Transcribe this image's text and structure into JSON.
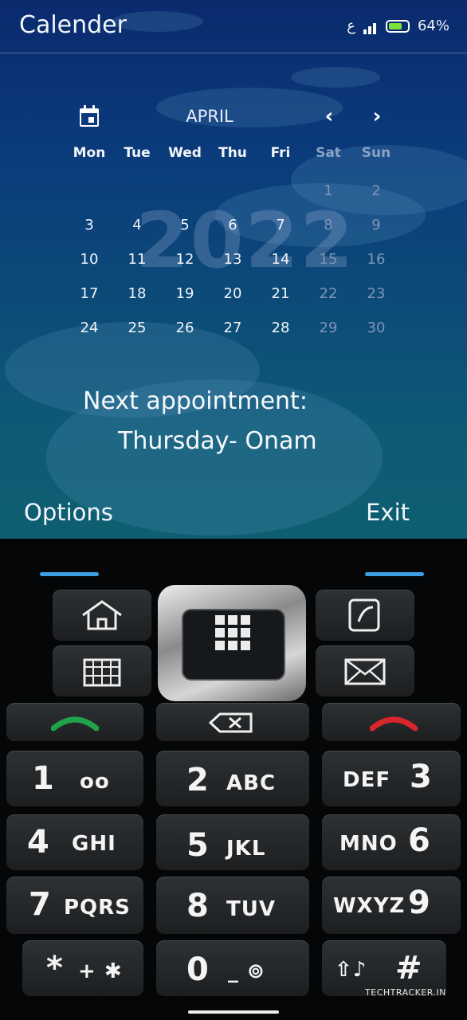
{
  "app": {
    "title": "Calender"
  },
  "status_bar": {
    "carrier_glyph": "ع",
    "battery_percent": "64%",
    "battery_level": 0.64,
    "signal_icon": "signal-bars-icon"
  },
  "calendar": {
    "month": "APRIL",
    "year": "2022",
    "prev_icon": "‹",
    "next_icon": "›",
    "weekdays": [
      "Mon",
      "Tue",
      "Wed",
      "Thu",
      "Fri",
      "Sat",
      "Sun"
    ],
    "weeks": [
      [
        "",
        "",
        "",
        "",
        "",
        "1",
        "2"
      ],
      [
        "3",
        "4",
        "5",
        "6",
        "7",
        "8",
        "9"
      ],
      [
        "10",
        "11",
        "12",
        "13",
        "14",
        "15",
        "16"
      ],
      [
        "17",
        "18",
        "19",
        "20",
        "21",
        "22",
        "23"
      ],
      [
        "24",
        "25",
        "26",
        "27",
        "28",
        "29",
        "30"
      ]
    ]
  },
  "appointment": {
    "label": "Next appointment:",
    "value": "Thursday- Onam"
  },
  "softkeys": {
    "left": "Options",
    "right": "Exit"
  },
  "keypad": {
    "keys": [
      {
        "digit": "1",
        "letters": "oo"
      },
      {
        "digit": "2",
        "letters": "ABC"
      },
      {
        "digit": "3",
        "letters": "DEF"
      },
      {
        "digit": "4",
        "letters": "GHI"
      },
      {
        "digit": "5",
        "letters": "JKL"
      },
      {
        "digit": "6",
        "letters": "MNO"
      },
      {
        "digit": "7",
        "letters": "PQRS"
      },
      {
        "digit": "8",
        "letters": "TUV"
      },
      {
        "digit": "9",
        "letters": "WXYZ"
      },
      {
        "digit": "*",
        "letters": "+ ✱"
      },
      {
        "digit": "0",
        "letters": "_ ⊚"
      },
      {
        "digit": "#",
        "letters": "⇧♪"
      }
    ]
  },
  "watermark": "TECHTRACKER.IN",
  "colors": {
    "accent_blue": "#3aa0e0",
    "call_green": "#1fa34a",
    "end_red": "#d8262b",
    "battery_green": "#7ee03a"
  }
}
